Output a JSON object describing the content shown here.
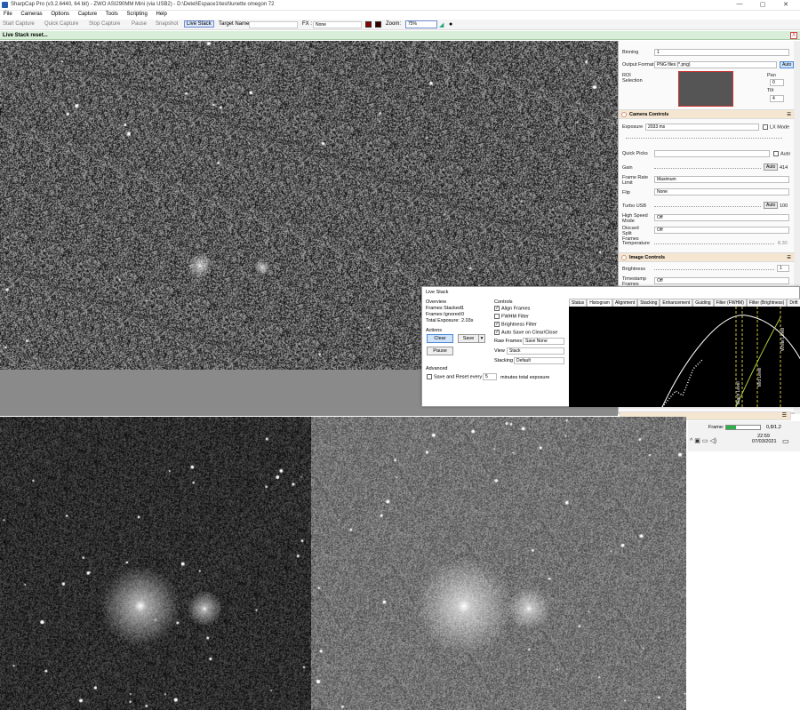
{
  "window": {
    "title": "SharpCap Pro (v3.2.6440, 64 bit) - ZWO ASI290MM Mini (via USB2) - D:\\Detel\\Espace1\\test\\lunette omegon 72",
    "controls": [
      "—",
      "▢",
      "✕"
    ]
  },
  "menu": [
    "File",
    "Cameras",
    "Options",
    "Capture",
    "Tools",
    "Scripting",
    "Help"
  ],
  "toolbar": {
    "start_capture": "Start Capture",
    "quick_capture": "Quick Capture",
    "stop_capture": "Stop Capture",
    "pause": "Pause",
    "snapshot": "Snapshot",
    "live_stack": "Live Stack",
    "target_name_label": "Target Name :",
    "fx_label": "FX :",
    "fx_value": "None",
    "zoom_label": "Zoom:",
    "zoom_value": "75%"
  },
  "status": {
    "message": "Live Stack reset...",
    "close": "X"
  },
  "side_panel": {
    "binning_label": "Binning",
    "binning_value": "1",
    "output_format_label": "Output Format",
    "output_format_value": "PNG files (*.png)",
    "output_auto": "Auto",
    "roi_label": "ROI Selection",
    "pan_label": "Pan",
    "pan_value": "0",
    "tilt_label": "Tilt",
    "tilt_value": "4",
    "camera_controls_title": "Camera Controls",
    "exposure_label": "Exposure",
    "exposure_value": "2033 ms",
    "lx_mode_label": "LX Mode",
    "quick_picks_label": "Quick Picks",
    "quick_picks_auto": "Auto",
    "gain_label": "Gain",
    "gain_auto": "Auto",
    "gain_value": "414",
    "frame_rate_label": "Frame Rate Limit",
    "frame_rate_value": "Maximum",
    "flip_label": "Flip",
    "flip_value": "None",
    "turbo_usb_label": "Turbo USB",
    "turbo_auto": "Auto",
    "turbo_value": "100",
    "high_speed_label": "High Speed Mode",
    "high_speed_value": "Off",
    "discard_split_label": "Discard Split Frames",
    "discard_split_value": "Off",
    "temperature_label": "Temperature",
    "temperature_value": "8.30",
    "image_controls_title": "Image Controls",
    "brightness_label": "Brightness",
    "brightness_value": "1",
    "timestamp_label": "Timestamp Frames",
    "timestamp_value": "Off"
  },
  "live_stack": {
    "title": "Live Stack",
    "overview_label": "Overview",
    "frames_stacked_label": "Frames Stacked:",
    "frames_stacked_value": "1",
    "frames_ignored_label": "Frames Ignored:",
    "frames_ignored_value": "0",
    "total_exposure_label": "Total Exposure:",
    "total_exposure_value": "2.03s",
    "actions_label": "Actions",
    "clear_button": "Clear",
    "save_button": "Save",
    "pause_button": "Pause",
    "advanced_label": "Advanced",
    "save_reset_label": "Save and Reset every",
    "save_reset_value": "5",
    "save_reset_suffix": "minutes total exposure",
    "controls_label": "Controls",
    "align_frames": "Align Frames",
    "fwhm_filter": "FWHM Filter",
    "brightness_filter": "Brightness Filter",
    "auto_save": "Auto Save on Clear/Close",
    "raw_frames_label": "Raw Frames",
    "raw_frames_value": "Save None",
    "view_label": "View",
    "view_value": "Stack",
    "stacking_label": "Stacking",
    "stacking_value": "Default",
    "tabs": [
      "Status",
      "Histogram",
      "Alignment",
      "Stacking",
      "Enhancement",
      "Guiding",
      "Filter (FWHM)",
      "Filter (Brightness)",
      "Drift"
    ],
    "histogram_labels": [
      "Black Level",
      "Mid Level",
      "White Level"
    ]
  },
  "taskbar": {
    "frame_label": "Frame:",
    "frame_value": "0,8/1,2",
    "time": "22:59",
    "date": "07/03/2021"
  }
}
